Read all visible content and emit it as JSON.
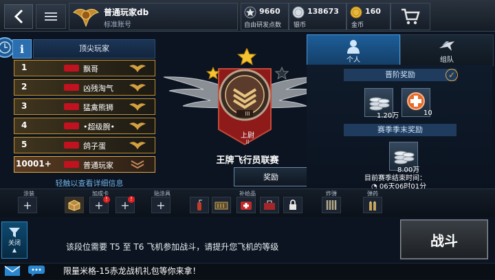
{
  "header": {
    "player_name": "普通玩家db",
    "account_type": "标准账号",
    "resources": [
      {
        "value": "9660",
        "label": "自由研发点数",
        "icon": "star-icon"
      },
      {
        "value": "138673",
        "label": "银币",
        "icon": "silver-coin-icon"
      },
      {
        "value": "160",
        "label": "金币",
        "icon": "gold-coin-icon"
      }
    ]
  },
  "leaderboard": {
    "title": "顶尖玩家",
    "rows": [
      {
        "rank": "1",
        "name": "飘哥"
      },
      {
        "rank": "2",
        "name": "凶残淘气"
      },
      {
        "rank": "3",
        "name": "猛禽熊狮"
      },
      {
        "rank": "4",
        "name": "•超级腕•"
      },
      {
        "rank": "5",
        "name": "鸽子蛋"
      },
      {
        "rank": "10001+",
        "name": "普通玩家"
      }
    ],
    "hint": "轻触以查看详细信息"
  },
  "center": {
    "rank_label": "上尉",
    "rank_numeral": "III",
    "rank_sub": "II",
    "league_title": "王牌飞行员联赛",
    "reward_button": "奖励"
  },
  "right_panel": {
    "tabs": [
      {
        "label": "个人"
      },
      {
        "label": "组队"
      }
    ],
    "promotion_title": "晋阶奖励",
    "promotion_items": [
      {
        "value": "1.20万"
      },
      {
        "value": "10"
      }
    ],
    "season_title": "赛季季末奖励",
    "season_item": {
      "value": "8.00万"
    },
    "season_end_label": "目前赛季结束时间：",
    "season_end_time": "06天06时01分"
  },
  "equipment": {
    "labels": [
      "涂装",
      "加成卡",
      "贴涂具",
      "补给品",
      "炸弹",
      "弹药"
    ]
  },
  "footer": {
    "filter_label": "关闭",
    "notice": "该段位需要 T5 至 T6 飞机参加战斗，请提升您飞机的等级",
    "battle_button": "战斗",
    "ticker": "限量米格-15赤龙战机礼包等你来拿！"
  },
  "colors": {
    "accent_blue": "#2b6fb0",
    "gold": "#c8912c",
    "emblem_red": "#8e1a1a"
  }
}
